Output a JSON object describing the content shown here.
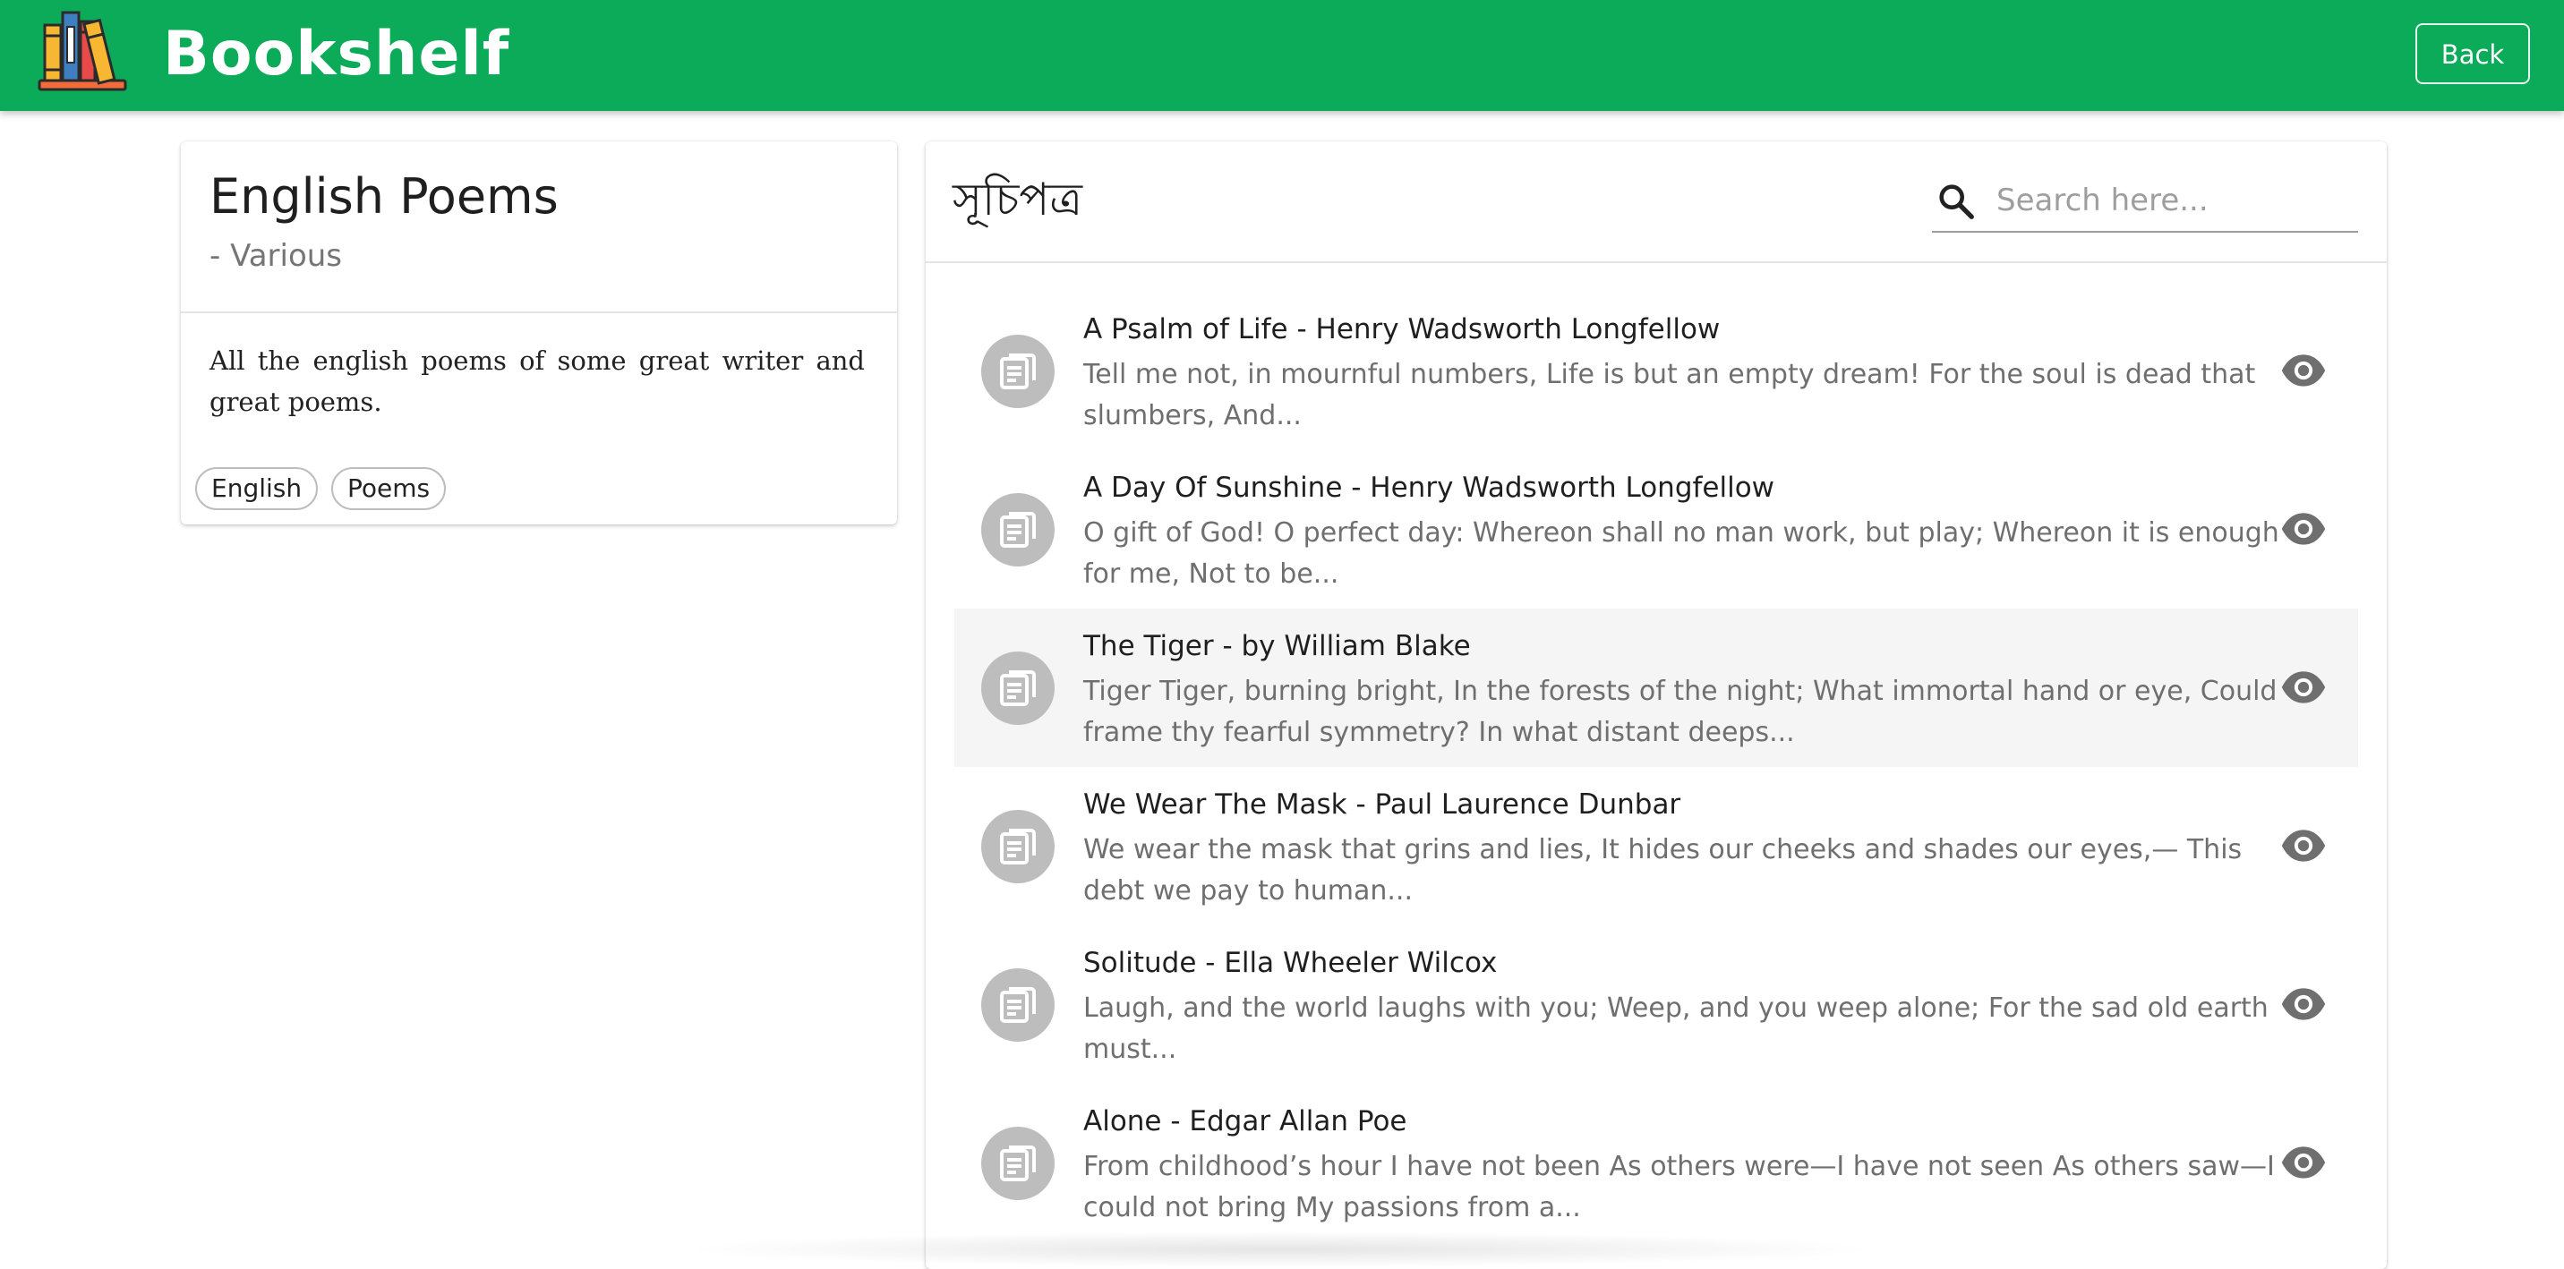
{
  "app": {
    "brand": "Bookshelf",
    "back_label": "Back",
    "logo_icon": "bookshelf-logo-icon",
    "accent_color": "#0cab5a"
  },
  "book": {
    "title": "English Poems",
    "author": "- Various",
    "description": "All the english poems of some great writer and great poems.",
    "tags": [
      "English",
      "Poems"
    ]
  },
  "contents": {
    "title": "সূচিপত্র",
    "search_placeholder": "Search here...",
    "search_value": "",
    "items": [
      {
        "title": "A Psalm of Life - Henry Wadsworth Longfellow",
        "excerpt": "Tell me not, in mournful numbers, Life is but an empty dream! For the soul is dead that slumbers, And...",
        "icon": "article-icon",
        "action_icon": "eye-icon"
      },
      {
        "title": "A Day Of Sunshine - Henry Wadsworth Longfellow",
        "excerpt": "O gift of God! O perfect day: Whereon shall no man work, but play; Whereon it is enough for me, Not to be...",
        "icon": "article-icon",
        "action_icon": "eye-icon"
      },
      {
        "title": "The Tiger - by William Blake",
        "excerpt": "Tiger Tiger, burning bright, In the forests of the night; What immortal hand or eye, Could frame thy fearful symmetry? In what distant deeps...",
        "icon": "article-icon",
        "action_icon": "eye-icon"
      },
      {
        "title": "We Wear The Mask - Paul Laurence Dunbar",
        "excerpt": "We wear the mask that grins and lies, It hides our cheeks and shades our eyes,— This debt we pay to human...",
        "icon": "article-icon",
        "action_icon": "eye-icon"
      },
      {
        "title": "Solitude - Ella Wheeler Wilcox",
        "excerpt": "Laugh, and the world laughs with you; Weep, and you weep alone; For the sad old earth must...",
        "icon": "article-icon",
        "action_icon": "eye-icon"
      },
      {
        "title": "Alone - Edgar Allan Poe",
        "excerpt": "From childhood’s hour I have not been As others were—I have not seen As others saw—I could not bring My passions from a...",
        "icon": "article-icon",
        "action_icon": "eye-icon"
      }
    ]
  }
}
